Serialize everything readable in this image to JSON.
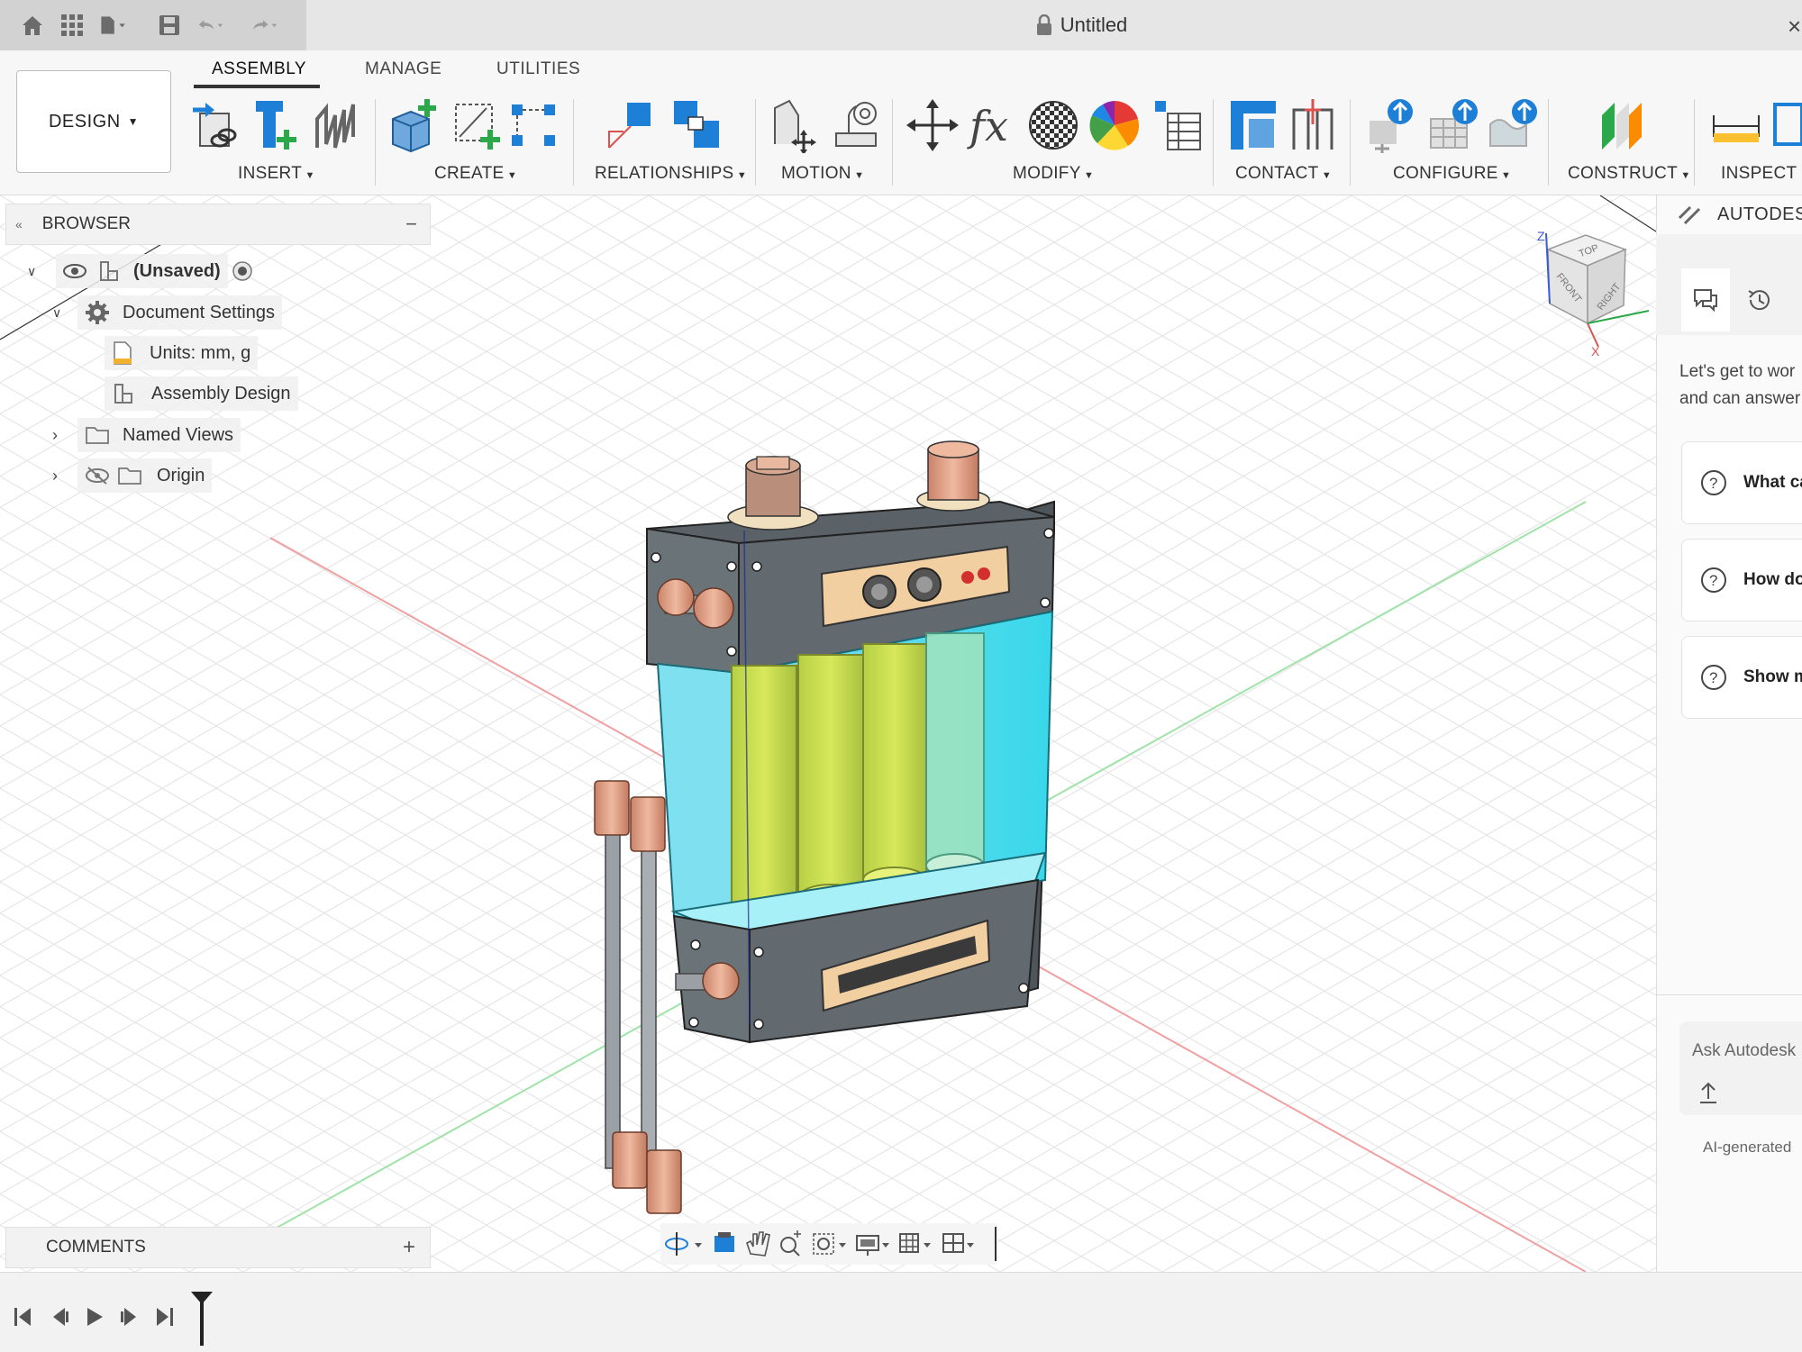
{
  "titlebar": {
    "doc_title": "Untitled",
    "close_label": "×"
  },
  "ribbon": {
    "workspace": "DESIGN",
    "tabs": [
      "ASSEMBLY",
      "MANAGE",
      "UTILITIES"
    ],
    "groups": [
      "INSERT",
      "CREATE",
      "RELATIONSHIPS",
      "MOTION",
      "MODIFY",
      "CONTACT",
      "CONFIGURE",
      "CONSTRUCT",
      "INSPECT"
    ]
  },
  "browser": {
    "title": "BROWSER",
    "items": [
      {
        "label": "(Unsaved)"
      },
      {
        "label": "Document Settings"
      },
      {
        "label": "Units: mm, g"
      },
      {
        "label": "Assembly Design"
      },
      {
        "label": "Named Views"
      },
      {
        "label": "Origin"
      }
    ]
  },
  "comments": {
    "title": "COMMENTS",
    "add": "+"
  },
  "viewcube": {
    "top": "TOP",
    "front": "FRONT",
    "right": "RIGHT",
    "axis_z": "Z",
    "axis_x": "X"
  },
  "assistant": {
    "title": "AUTODESK",
    "intro_line1": "Let's get to wor",
    "intro_line2": "and can answer",
    "questions": [
      "What ca",
      "How do",
      "Show m"
    ],
    "input_placeholder": "Ask Autodesk",
    "footer": "AI-generated"
  },
  "colors": {
    "accent_blue": "#1e7fd6",
    "add_green": "#2ba84a",
    "fluid_cyan": "#5fdcef",
    "cylinder_yellow": "#c9de4a",
    "copper": "#d9967a",
    "casing_gray": "#626a70"
  }
}
